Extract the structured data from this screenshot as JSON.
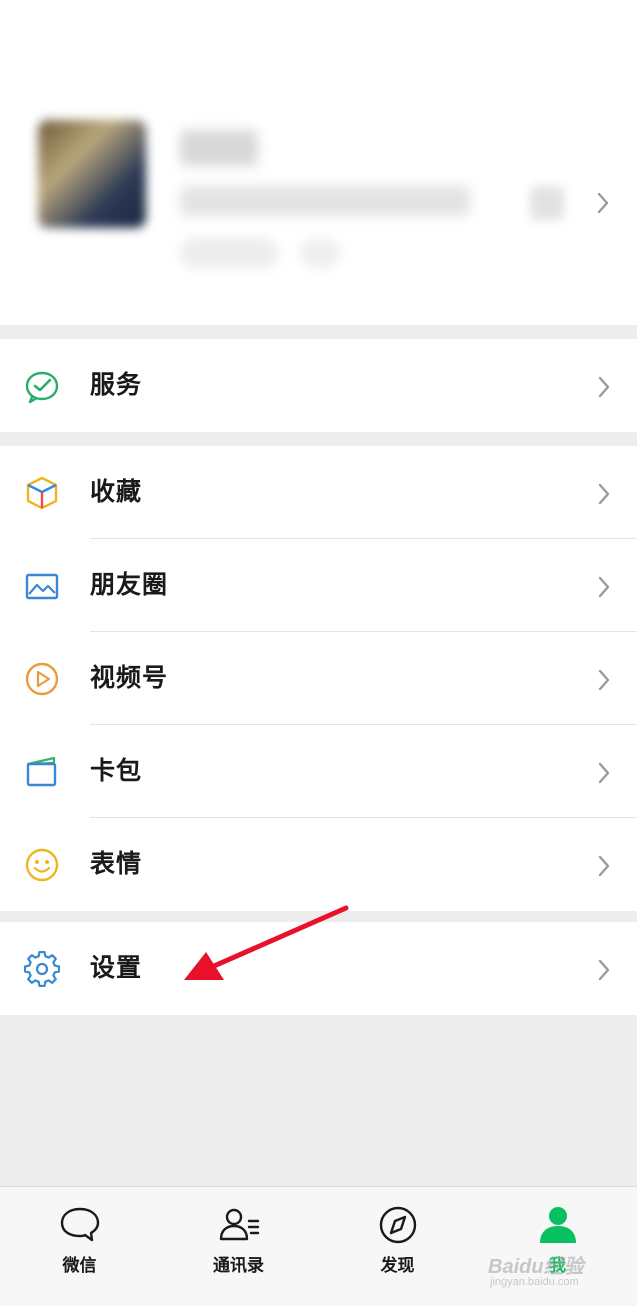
{
  "profile": {
    "nickname": "",
    "wechat_id": ""
  },
  "menu": {
    "services": {
      "label": "服务",
      "icon": "services-icon"
    },
    "favorites": {
      "label": "收藏",
      "icon": "favorites-icon"
    },
    "moments": {
      "label": "朋友圈",
      "icon": "moments-icon"
    },
    "channels": {
      "label": "视频号",
      "icon": "channels-icon"
    },
    "cards": {
      "label": "卡包",
      "icon": "card-wallet-icon"
    },
    "stickers": {
      "label": "表情",
      "icon": "sticker-icon"
    },
    "settings": {
      "label": "设置",
      "icon": "gear-icon"
    }
  },
  "tabbar": {
    "tabs": [
      {
        "label": "微信",
        "icon": "chat-icon",
        "active": false
      },
      {
        "label": "通讯录",
        "icon": "contacts-icon",
        "active": false
      },
      {
        "label": "发现",
        "icon": "compass-icon",
        "active": false
      },
      {
        "label": "我",
        "icon": "me-icon",
        "active": true
      }
    ]
  },
  "watermark": {
    "text": "Baidu经验",
    "sub": "jingyan.baidu.com"
  },
  "colors": {
    "accent_green": "#07c160",
    "background": "#ededed",
    "annotation_arrow": "#e8102a"
  }
}
